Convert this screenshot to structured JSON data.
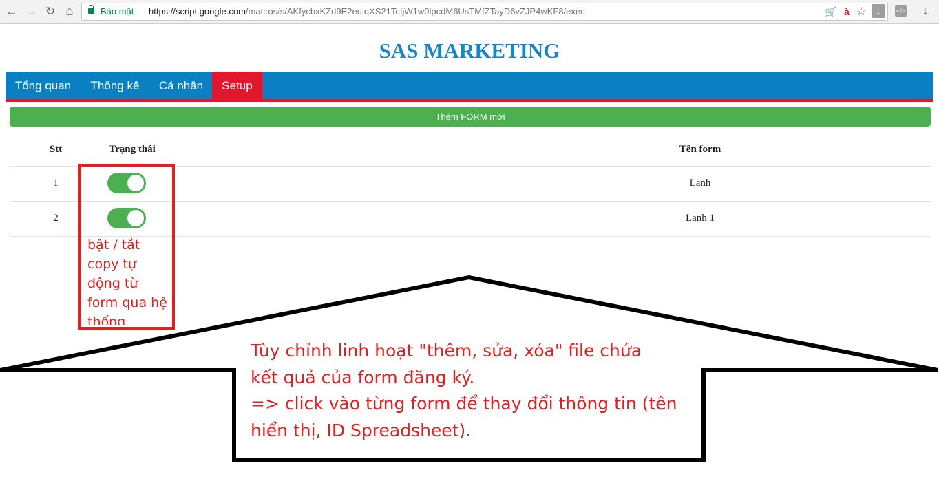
{
  "browser": {
    "secure_label": "Bảo mật",
    "url_host": "https://script.google.com",
    "url_path": "/macros/s/AKfycbxKZd9E2euiqXS21TcIjW1w0lpcdM6UsTMfZTayD6vZJP4wKF8/exec",
    "back_glyph": "←",
    "forward_glyph": "→",
    "reload_glyph": "↻",
    "home_glyph": "⌂",
    "translate_glyph": "à",
    "star_glyph": "☆",
    "cart_glyph": "🛒",
    "ext_code_glyph": "</>",
    "download_glyph": "↓"
  },
  "page": {
    "title": "SAS MARKETING",
    "nav": [
      "Tổng quan",
      "Thống kê",
      "Cá nhân",
      "Setup"
    ],
    "active_nav": "Setup",
    "add_form_button": "Thêm FORM mới"
  },
  "table": {
    "headers": {
      "stt": "Stt",
      "status": "Trạng thái",
      "name": "Tên form"
    },
    "rows": [
      {
        "stt": "1",
        "enabled": true,
        "name": "Lanh"
      },
      {
        "stt": "2",
        "enabled": true,
        "name": "Lanh 1"
      }
    ]
  },
  "annotations": {
    "toggle_note": [
      "bật / tắt",
      "copy tự",
      "động  từ",
      "form qua hệ",
      "thống"
    ],
    "callout_note": [
      "Tùy chỉnh linh hoạt \"thêm, sửa, xóa\" file chứa",
      "kết quả của form đăng ký.",
      "=> click vào từng form để thay đổi thông tin (tên",
      "hiển thị, ID Spreadsheet)."
    ]
  },
  "colors": {
    "nav_bg": "#0a7fc2",
    "nav_active": "#e0182e",
    "button_green": "#4caf50",
    "title_blue": "#1a85c5",
    "annotation_red": "#e02020"
  }
}
